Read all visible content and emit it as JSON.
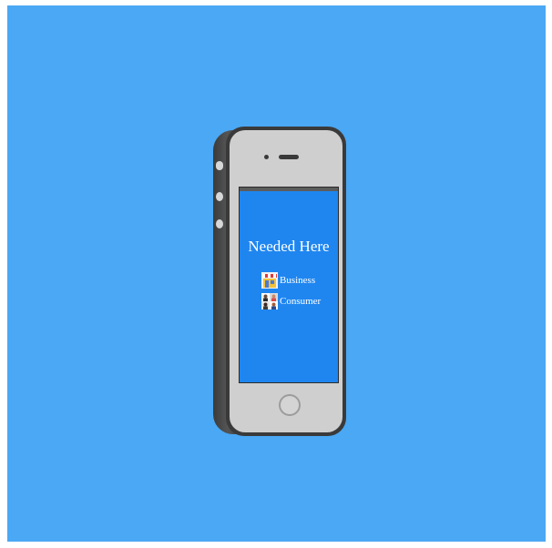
{
  "app": {
    "title": "Needed Here",
    "menu": [
      {
        "label": "Business",
        "icon": "storefront-icon"
      },
      {
        "label": "Consumer",
        "icon": "people-icon"
      }
    ]
  },
  "colors": {
    "background": "#4aa8f4",
    "screen": "#1f86f0",
    "phone_body": "#3a3a3a",
    "phone_face": "#cfcfcf"
  }
}
